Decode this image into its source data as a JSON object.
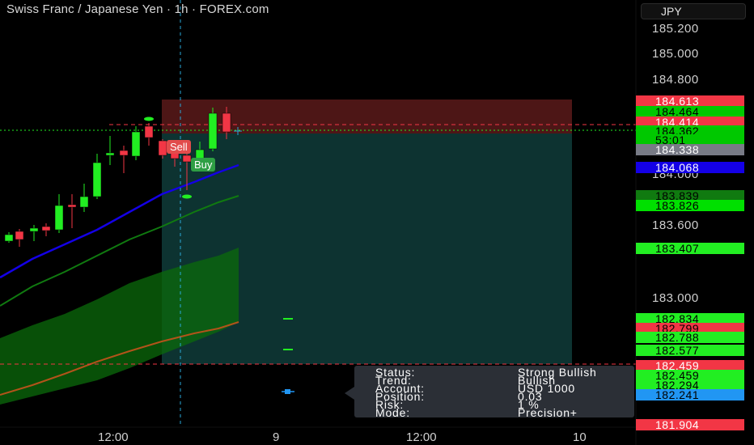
{
  "header": {
    "title": "Swiss Franc / Japanese Yen · 1h · FOREX.com",
    "currency": "JPY"
  },
  "price_axis": {
    "ticks": [
      "185.200",
      "185.000",
      "184.800",
      "184.000",
      "183.600",
      "183.000"
    ]
  },
  "price_labels": [
    {
      "text": "184.613",
      "bg": "#f23645",
      "fg": "#ffffff"
    },
    {
      "text": "184.464",
      "bg": "#00c800",
      "fg": "#000000"
    },
    {
      "text": "184.414",
      "bg": "#f23645",
      "fg": "#ffffff"
    },
    {
      "text": "184.362",
      "bg": "#00c800",
      "fg": "#000000"
    },
    {
      "text": "53:01",
      "bg": "#00c800",
      "fg": "#000000"
    },
    {
      "text": "184.338",
      "bg": "#787b86",
      "fg": "#ffffff"
    },
    {
      "text": "184.068",
      "bg": "#1400e6",
      "fg": "#ffffff"
    },
    {
      "text": "183.839",
      "bg": "#107a10",
      "fg": "#000000"
    },
    {
      "text": "183.826",
      "bg": "#00e000",
      "fg": "#000000"
    },
    {
      "text": "183.407",
      "bg": "#22ee22",
      "fg": "#000000"
    },
    {
      "text": "182.834",
      "bg": "#22ee22",
      "fg": "#000000"
    },
    {
      "text": "182.799",
      "bg": "#f23645",
      "fg": "#000000"
    },
    {
      "text": "182.788",
      "bg": "#22ee22",
      "fg": "#000000"
    },
    {
      "text": "182.577",
      "bg": "#22ee22",
      "fg": "#000000"
    },
    {
      "text": "182.459",
      "bg": "#f23645",
      "fg": "#ffffff"
    },
    {
      "text": "182.459",
      "bg": "#22ee22",
      "fg": "#000000"
    },
    {
      "text": "182.294",
      "bg": "#22ee22",
      "fg": "#000000"
    },
    {
      "text": "182.241",
      "bg": "#2196f3",
      "fg": "#000000"
    },
    {
      "text": "181.904",
      "bg": "#f23645",
      "fg": "#ffffff"
    }
  ],
  "time_axis": {
    "labels": [
      "12:00",
      "9",
      "12:00",
      "10"
    ]
  },
  "signals": {
    "sell": "Sell",
    "buy": "Buy"
  },
  "info_panel": {
    "rows": [
      {
        "key": "Status:",
        "value": "Strong Bullish"
      },
      {
        "key": "Trend:",
        "value": "Bullish"
      },
      {
        "key": "Account:",
        "value": "USD 1000"
      },
      {
        "key": "Position:",
        "value": "0.03"
      },
      {
        "key": "Risk:",
        "value": "1 %"
      },
      {
        "key": "Mode:",
        "value": "Precision+"
      }
    ]
  },
  "colors": {
    "bull": "#22ee22",
    "bear": "#f23645",
    "ema_fast": "#1400e6",
    "ema_slow": "#107a10",
    "cloud": "#0b6b0b",
    "cursor": "#2aa8d8"
  }
}
